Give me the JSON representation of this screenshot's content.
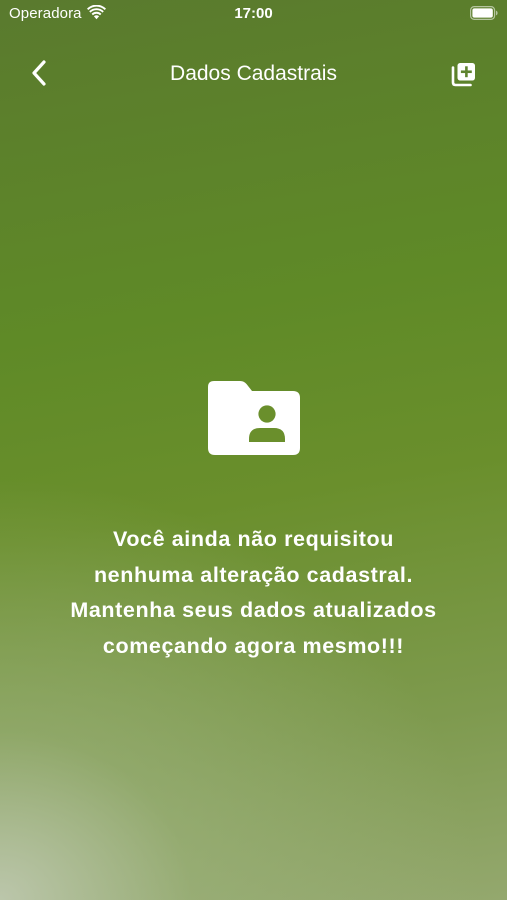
{
  "status_bar": {
    "carrier": "Operadora",
    "time": "17:00",
    "wifi_icon": "wifi-icon",
    "battery_icon": "battery-icon"
  },
  "nav": {
    "back_icon": "chevron-left-icon",
    "title": "Dados Cadastrais",
    "add_icon": "add-copy-icon"
  },
  "empty_state": {
    "icon": "folder-user-icon",
    "message_lines": [
      "Você ainda não requisitou",
      "nenhuma alteração cadastral.",
      "Mantenha seus dados atualizados",
      "começando agora mesmo!!!"
    ]
  },
  "colors": {
    "background_top": "#5a7a2e",
    "background_mid": "#6a8f2c",
    "background_bottom_left": "#bec8af",
    "foreground": "#ffffff"
  }
}
